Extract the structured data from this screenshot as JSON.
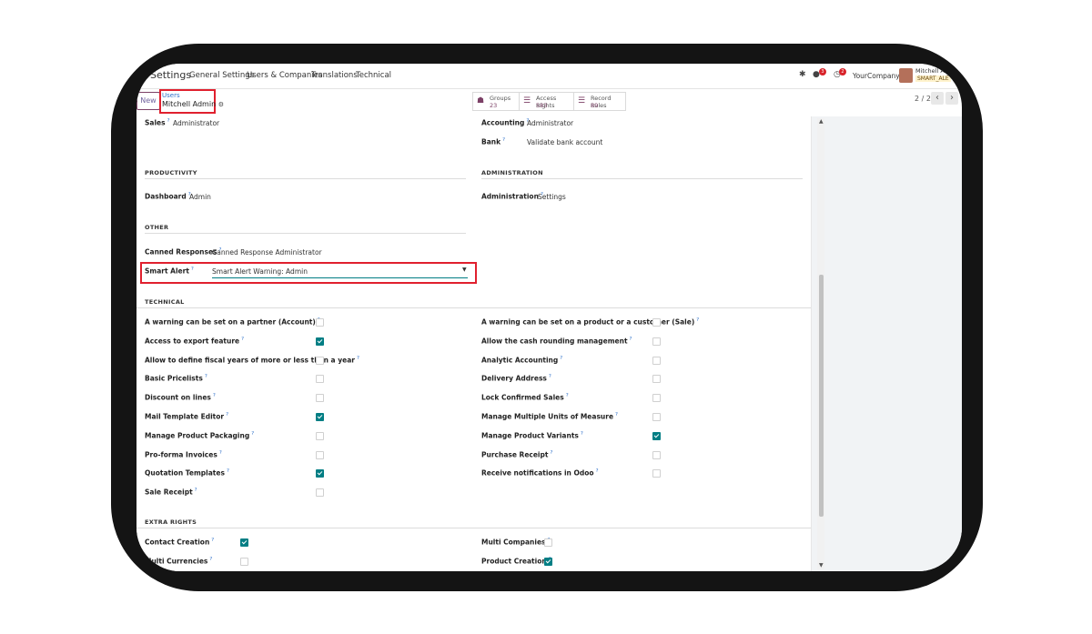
{
  "nav": {
    "app": "Settings",
    "menu": [
      "General Settings",
      "Users & Companies",
      "Translations",
      "Technical"
    ],
    "chat_badge": "3",
    "activity_badge": "2",
    "company": "YourCompany",
    "user_name": "Mitchell Ad",
    "user_db": "SMART_ALE"
  },
  "control": {
    "new_label": "New",
    "breadcrumb_link": "Users",
    "breadcrumb_current": "Mitchell Admin",
    "stats": [
      {
        "label": "Groups",
        "value": "23"
      },
      {
        "label": "Access Rights",
        "value": "583"
      },
      {
        "label": "Record Rules",
        "value": "89"
      }
    ],
    "pager": "2 / 2"
  },
  "form": {
    "q": "?",
    "sales": {
      "label": "Sales",
      "value": "Administrator"
    },
    "accounting": {
      "label": "Accounting",
      "value": "Administrator"
    },
    "bank": {
      "label": "Bank",
      "value": "Validate bank account"
    },
    "productivity": "PRODUCTIVITY",
    "administration_section": "ADMINISTRATION",
    "dashboard": {
      "label": "Dashboard",
      "value": "Admin"
    },
    "administration": {
      "label": "Administration",
      "value": "Settings"
    },
    "other": "OTHER",
    "canned": {
      "label": "Canned Responses",
      "value": "Canned Response Administrator"
    },
    "smart_alert": {
      "label": "Smart Alert",
      "value": "Smart Alert Warning: Admin"
    },
    "technical": "TECHNICAL",
    "technical_left": [
      {
        "label": "A warning can be set on a partner (Account)",
        "checked": false
      },
      {
        "label": "Access to export feature",
        "checked": true
      },
      {
        "label": "Allow to define fiscal years of more or less than a year",
        "checked": false
      },
      {
        "label": "Basic Pricelists",
        "checked": false
      },
      {
        "label": "Discount on lines",
        "checked": false
      },
      {
        "label": "Mail Template Editor",
        "checked": true
      },
      {
        "label": "Manage Product Packaging",
        "checked": false
      },
      {
        "label": "Pro-forma Invoices",
        "checked": false
      },
      {
        "label": "Quotation Templates",
        "checked": true
      },
      {
        "label": "Sale Receipt",
        "checked": false
      }
    ],
    "technical_right": [
      {
        "label": "A warning can be set on a product or a customer (Sale)",
        "checked": false
      },
      {
        "label": "Allow the cash rounding management",
        "checked": false
      },
      {
        "label": "Analytic Accounting",
        "checked": false
      },
      {
        "label": "Delivery Address",
        "checked": false
      },
      {
        "label": "Lock Confirmed Sales",
        "checked": false
      },
      {
        "label": "Manage Multiple Units of Measure",
        "checked": false
      },
      {
        "label": "Manage Product Variants",
        "checked": true
      },
      {
        "label": "Purchase Receipt",
        "checked": false
      },
      {
        "label": "Receive notifications in Odoo",
        "checked": false
      }
    ],
    "extra": "EXTRA RIGHTS",
    "extra_left": [
      {
        "label": "Contact Creation",
        "checked": true
      },
      {
        "label": "Multi Currencies",
        "checked": false
      }
    ],
    "extra_right": [
      {
        "label": "Multi Companies",
        "checked": false
      },
      {
        "label": "Product Creation",
        "checked": true
      }
    ]
  },
  "colors": {
    "accent": "#017e84",
    "brand": "#7c4066",
    "highlight": "#e0202e"
  }
}
